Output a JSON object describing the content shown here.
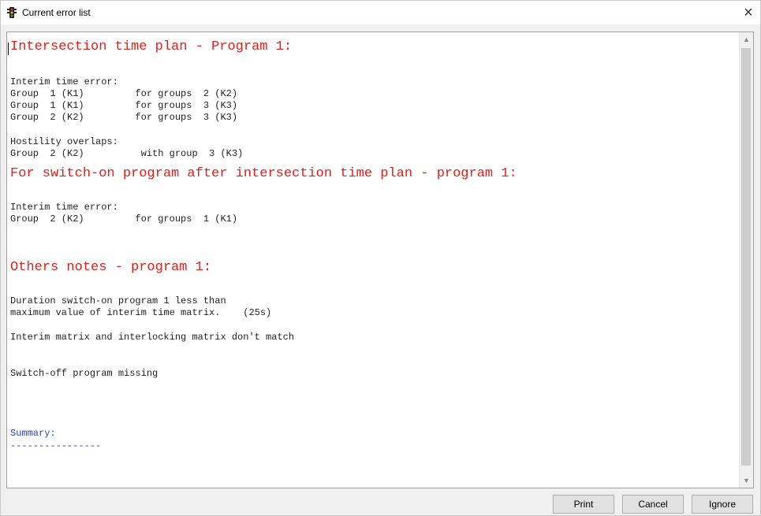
{
  "window": {
    "title": "Current error list",
    "close_glyph": "×",
    "icon": "traffic-light-icon"
  },
  "content": {
    "heading1": "Intersection time plan - Program 1:",
    "interim_header": "Interim time error:",
    "interim_rows": [
      "Group  1 (K1)         for groups  2 (K2)",
      "Group  1 (K1)         for groups  3 (K3)",
      "Group  2 (K2)         for groups  3 (K3)"
    ],
    "hostility_header": "Hostility overlaps:",
    "hostility_rows": [
      "Group  2 (K2)          with group  3 (K3)"
    ],
    "heading2": "For switch-on program after intersection time plan - program 1:",
    "interim2_header": "Interim time error:",
    "interim2_rows": [
      "Group  2 (K2)         for groups  1 (K1)"
    ],
    "heading3": "Others notes - program 1:",
    "notes": [
      "Duration switch-on program 1 less than",
      "maximum value of interim time matrix.    (25s)",
      "Interim matrix and interlocking matrix don't match",
      "Switch-off program missing"
    ],
    "summary_label": "Summary:",
    "summary_rule": "----------------"
  },
  "buttons": {
    "print": "Print",
    "cancel": "Cancel",
    "ignore": "Ignore"
  },
  "colors": {
    "heading": "#e0201b",
    "summary": "#2a3fc8"
  }
}
